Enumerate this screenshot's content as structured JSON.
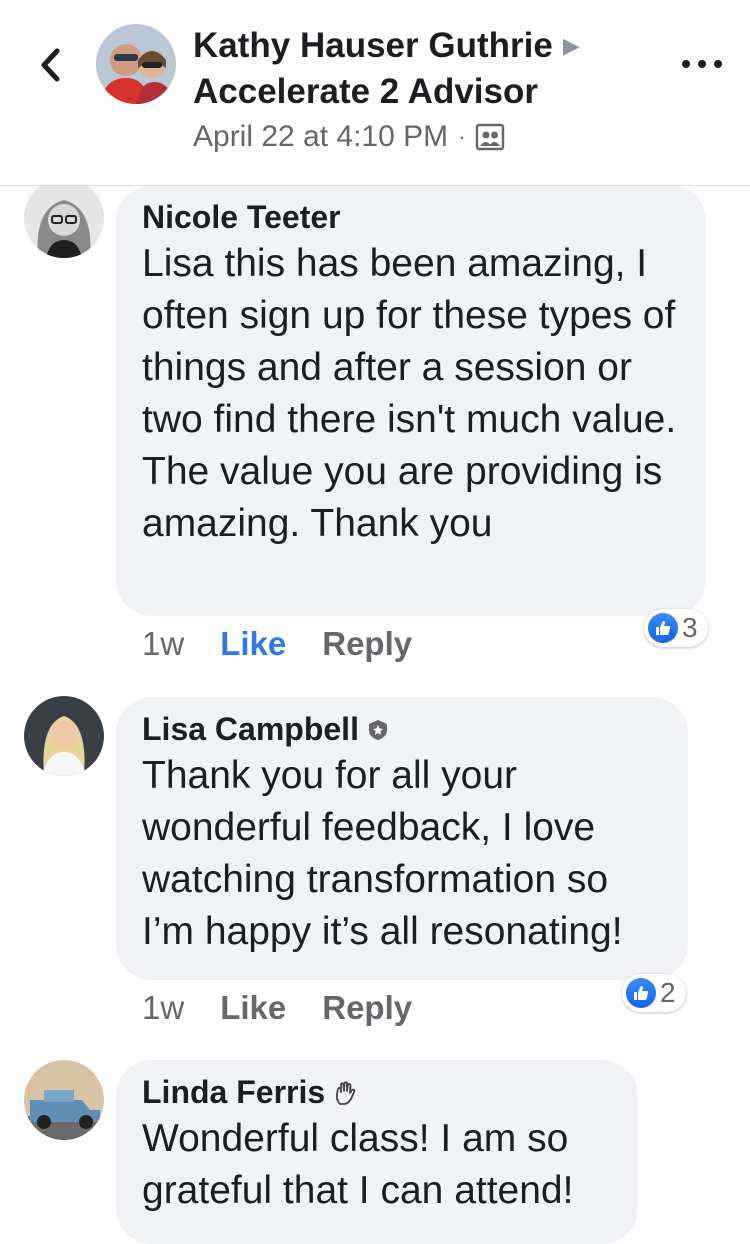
{
  "header": {
    "author": "Kathy Hauser Guthrie",
    "group": "Accelerate 2 Advisor",
    "timestamp": "April 22 at 4:10 PM",
    "separator": "·"
  },
  "comments": [
    {
      "name": "Nicole Teeter",
      "text": "Lisa this has been amazing, I often sign up for these types of things and after a session or two find there isn't much value. The value you are providing is amazing. Thank you",
      "time": "1w",
      "like_label": "Like",
      "reply_label": "Reply",
      "reaction_count": "3",
      "liked": true
    },
    {
      "name": "Lisa Campbell",
      "text": "Thank you for all your wonderful feedback, I love watching transformation so I’m happy it’s all resonating!",
      "time": "1w",
      "like_label": "Like",
      "reply_label": "Reply",
      "reaction_count": "2",
      "liked": false,
      "badge_icon": "admin-shield-icon"
    },
    {
      "name": "Linda Ferris",
      "text": "Wonderful class!  I am so grateful that I can attend!",
      "badge_icon": "waving-hand-icon"
    }
  ],
  "colors": {
    "accent": "#2d7ae8",
    "bubble": "#f0f2f5",
    "secondary_text": "#65676b"
  }
}
